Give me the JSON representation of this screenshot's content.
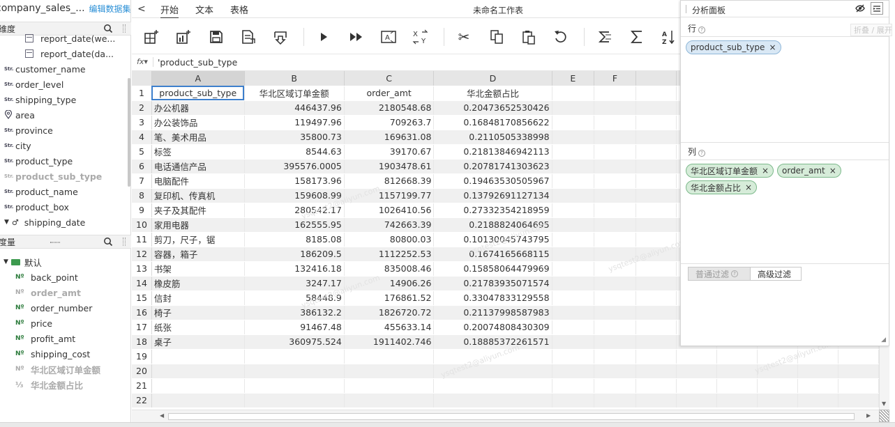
{
  "dataset": {
    "name": "company_sales_...",
    "edit_label": "编辑数据集"
  },
  "dimensions": {
    "header": "维度",
    "date_items": [
      "report_date(we...",
      "report_date(da..."
    ],
    "items": [
      {
        "label": "customer_name",
        "tag": "Str."
      },
      {
        "label": "order_level",
        "tag": "Str."
      },
      {
        "label": "shipping_type",
        "tag": "Str."
      },
      {
        "label": "area",
        "tag": "geo"
      },
      {
        "label": "province",
        "tag": "Str."
      },
      {
        "label": "city",
        "tag": "Str."
      },
      {
        "label": "product_type",
        "tag": "Str."
      },
      {
        "label": "product_sub_type",
        "tag": "Str."
      },
      {
        "label": "product_name",
        "tag": "Str."
      },
      {
        "label": "product_box",
        "tag": "Str."
      }
    ],
    "hierarchy": "shipping_date"
  },
  "measures": {
    "header": "度量",
    "group": "默认",
    "items": [
      {
        "label": "back_point",
        "tag": "Nº"
      },
      {
        "label": "order_amt",
        "tag": "Nº"
      },
      {
        "label": "order_number",
        "tag": "Nº"
      },
      {
        "label": "price",
        "tag": "Nº"
      },
      {
        "label": "profit_amt",
        "tag": "Nº"
      },
      {
        "label": "shipping_cost",
        "tag": "Nº"
      },
      {
        "label": "华北区域订单金额",
        "tag": "Nº"
      },
      {
        "label": "华北金额占比",
        "tag": "calc"
      }
    ]
  },
  "tabs": {
    "back": "<",
    "items": [
      "开始",
      "文本",
      "表格"
    ]
  },
  "sheet_title": "未命名工作表",
  "formula": {
    "fx": "fx▾",
    "value": "'product_sub_type"
  },
  "grid": {
    "col_headers": [
      "A",
      "B",
      "C",
      "D",
      "E",
      "F",
      "",
      "",
      "",
      "",
      "",
      ""
    ],
    "header_row": [
      "product_sub_type",
      "华北区域订单金额",
      "order_amt",
      "华北金额占比"
    ],
    "rows": [
      [
        "办公机器",
        "446437.96",
        "2180548.68",
        "0.20473652530426"
      ],
      [
        "办公装饰品",
        "119497.96",
        "709263.7",
        "0.16848170856622"
      ],
      [
        "笔、美术用品",
        "35800.73",
        "169631.08",
        "0.2110505338998"
      ],
      [
        "标签",
        "8544.63",
        "39170.67",
        "0.21813846942113"
      ],
      [
        "电话通信产品",
        "395576.0005",
        "1903478.61",
        "0.20781741303623"
      ],
      [
        "电脑配件",
        "158173.96",
        "812668.39",
        "0.19463530505967"
      ],
      [
        "复印机、传真机",
        "159608.99",
        "1157199.77",
        "0.13792691127134"
      ],
      [
        "夹子及其配件",
        "280542.17",
        "1026410.56",
        "0.27332354218959"
      ],
      [
        "家用电器",
        "162555.95",
        "742663.39",
        "0.2188824064695"
      ],
      [
        "剪刀，尺子，锯",
        "8185.08",
        "80800.03",
        "0.10130045743795"
      ],
      [
        "容器，箱子",
        "186209.5",
        "1112252.53",
        "0.1674165668115"
      ],
      [
        "书架",
        "132416.18",
        "835008.46",
        "0.15858064479969"
      ],
      [
        "橡皮筋",
        "3247.17",
        "14906.26",
        "0.21783935071574"
      ],
      [
        "信封",
        "58448.9",
        "176861.52",
        "0.33047833129558"
      ],
      [
        "椅子",
        "386132.2",
        "1826720.72",
        "0.21137998587983"
      ],
      [
        "纸张",
        "91467.48",
        "455633.14",
        "0.20074808430309"
      ],
      [
        "桌子",
        "360975.524",
        "1911402.746",
        "0.18885372261571"
      ]
    ],
    "row_numbers": [
      "1",
      "2",
      "3",
      "4",
      "5",
      "6",
      "7",
      "8",
      "9",
      "10",
      "11",
      "12",
      "13",
      "14",
      "15",
      "16",
      "17",
      "18",
      "19",
      "20",
      "21",
      "22"
    ]
  },
  "watermark": "ysqtest2@aliyun.com",
  "panel": {
    "title": "分析面板",
    "tooltip": "折叠 / 展开",
    "rows_label": "行",
    "row_chips": [
      "product_sub_type"
    ],
    "cols_label": "列",
    "col_chips": [
      "华北区域订单金额",
      "order_amt",
      "华北金额占比"
    ],
    "filter_normal": "普通过滤",
    "filter_advanced": "高级过滤"
  }
}
